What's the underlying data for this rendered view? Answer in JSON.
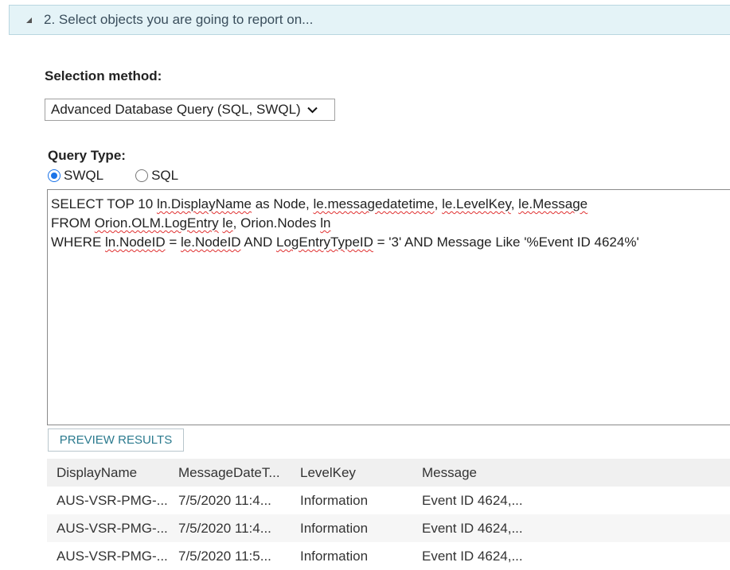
{
  "section": {
    "title": "2. Select objects you are going to report on..."
  },
  "selection_method": {
    "label": "Selection method:",
    "value": "Advanced Database Query (SQL, SWQL)"
  },
  "query_type": {
    "label": "Query Type:",
    "options": [
      {
        "label": "SWQL",
        "checked": true
      },
      {
        "label": "SQL",
        "checked": false
      }
    ]
  },
  "query": {
    "line1": {
      "a": "SELECT TOP 10 ",
      "b": "ln.DisplayName",
      "c": " as Node, ",
      "d": "le.messagedatetime",
      "e": ", ",
      "f": "le.LevelKey",
      "g": ", ",
      "h": "le.Message"
    },
    "line2": {
      "a": "FROM ",
      "b": "Orion.OLM.LogEntry",
      "c": " ",
      "d": "le",
      "e": ", Orion.Nodes ",
      "f": "ln"
    },
    "line3": {
      "a": "WHERE ",
      "b": "ln.NodeID",
      "c": " = ",
      "d": "le.NodeID",
      "e": " AND ",
      "f": "LogEntryTypeID",
      "g": " = '3' AND Message Like '%Event ID 4624%'"
    }
  },
  "preview_button": {
    "label": "PREVIEW RESULTS"
  },
  "results": {
    "columns": [
      "DisplayName",
      "MessageDateT...",
      "LevelKey",
      "Message"
    ],
    "rows": [
      [
        "AUS-VSR-PMG-...",
        "7/5/2020 11:4...",
        "Information",
        "Event ID 4624,..."
      ],
      [
        "AUS-VSR-PMG-...",
        "7/5/2020 11:4...",
        "Information",
        "Event ID 4624,..."
      ],
      [
        "AUS-VSR-PMG-...",
        "7/5/2020 11:5...",
        "Information",
        "Event ID 4624,..."
      ]
    ]
  },
  "icons": {
    "collapse": "collapse-triangle-icon",
    "dropdown": "chevron-down-icon"
  },
  "colors": {
    "header_bg": "#e4f3f7",
    "accent": "#2b7a8e",
    "radio_selected": "#1a73e8",
    "spell_underline": "#e03030"
  }
}
